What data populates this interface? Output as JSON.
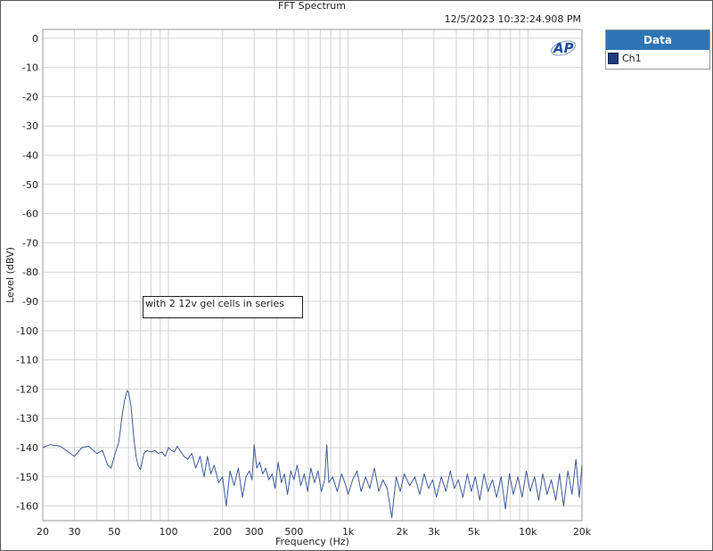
{
  "chart_data": {
    "type": "line",
    "title": "FFT Spectrum",
    "timestamp": "12/5/2023 10:32:24.908 PM",
    "xlabel": "Frequency (Hz)",
    "ylabel": "Level (dBV)",
    "xscale": "log",
    "xlim": [
      20,
      20000
    ],
    "ylim": [
      -165,
      3
    ],
    "grid": true,
    "legend_position": "right, outside plot",
    "legend_title": "Data",
    "annotation": "with 2 12v gel cells in series",
    "x_ticks": [
      {
        "value": 20,
        "label": "20"
      },
      {
        "value": 30,
        "label": "30"
      },
      {
        "value": 50,
        "label": "50"
      },
      {
        "value": 100,
        "label": "100"
      },
      {
        "value": 200,
        "label": "200"
      },
      {
        "value": 300,
        "label": "300"
      },
      {
        "value": 500,
        "label": "500"
      },
      {
        "value": 1000,
        "label": "1k"
      },
      {
        "value": 2000,
        "label": "2k"
      },
      {
        "value": 3000,
        "label": "3k"
      },
      {
        "value": 5000,
        "label": "5k"
      },
      {
        "value": 10000,
        "label": "10k"
      },
      {
        "value": 20000,
        "label": "20k"
      }
    ],
    "y_ticks": [
      0,
      -10,
      -20,
      -30,
      -40,
      -50,
      -60,
      -70,
      -80,
      -90,
      -100,
      -110,
      -120,
      -130,
      -140,
      -150,
      -160
    ],
    "series": [
      {
        "name": "Ch1",
        "color": "#3b5a9a",
        "points": [
          [
            20,
            -140
          ],
          [
            22,
            -139
          ],
          [
            25,
            -139.5
          ],
          [
            27,
            -141
          ],
          [
            30,
            -143
          ],
          [
            33,
            -140
          ],
          [
            36,
            -139.5
          ],
          [
            40,
            -142
          ],
          [
            43,
            -141
          ],
          [
            46,
            -146
          ],
          [
            48,
            -147
          ],
          [
            50,
            -143
          ],
          [
            53,
            -138
          ],
          [
            55,
            -130
          ],
          [
            57,
            -124
          ],
          [
            59,
            -120.5
          ],
          [
            60,
            -121
          ],
          [
            62,
            -126
          ],
          [
            64,
            -136
          ],
          [
            66,
            -143
          ],
          [
            68,
            -146.5
          ],
          [
            70,
            -147.5
          ],
          [
            73,
            -142
          ],
          [
            76,
            -141
          ],
          [
            80,
            -141.5
          ],
          [
            84,
            -141
          ],
          [
            88,
            -142
          ],
          [
            92,
            -141.5
          ],
          [
            96,
            -143
          ],
          [
            100,
            -140
          ],
          [
            104,
            -141
          ],
          [
            108,
            -141.5
          ],
          [
            112,
            -139.5
          ],
          [
            116,
            -141
          ],
          [
            122,
            -143
          ],
          [
            128,
            -144
          ],
          [
            135,
            -142
          ],
          [
            142,
            -147
          ],
          [
            150,
            -143
          ],
          [
            158,
            -150
          ],
          [
            165,
            -143
          ],
          [
            172,
            -149
          ],
          [
            180,
            -146
          ],
          [
            190,
            -152
          ],
          [
            200,
            -150
          ],
          [
            210,
            -160
          ],
          [
            220,
            -148
          ],
          [
            232,
            -153
          ],
          [
            245,
            -147
          ],
          [
            258,
            -157
          ],
          [
            270,
            -150
          ],
          [
            282,
            -148
          ],
          [
            292,
            -151
          ],
          [
            300,
            -139
          ],
          [
            310,
            -147
          ],
          [
            322,
            -145
          ],
          [
            335,
            -149
          ],
          [
            348,
            -147
          ],
          [
            362,
            -151
          ],
          [
            378,
            -149
          ],
          [
            392,
            -154
          ],
          [
            408,
            -145
          ],
          [
            425,
            -152
          ],
          [
            442,
            -149
          ],
          [
            460,
            -156
          ],
          [
            480,
            -148
          ],
          [
            500,
            -151
          ],
          [
            520,
            -146
          ],
          [
            545,
            -153
          ],
          [
            570,
            -149
          ],
          [
            595,
            -155
          ],
          [
            620,
            -147
          ],
          [
            650,
            -152
          ],
          [
            680,
            -148
          ],
          [
            710,
            -155
          ],
          [
            740,
            -151
          ],
          [
            760,
            -139
          ],
          [
            780,
            -152
          ],
          [
            820,
            -150
          ],
          [
            870,
            -155
          ],
          [
            920,
            -149
          ],
          [
            970,
            -153
          ],
          [
            1000,
            -156
          ],
          [
            1060,
            -151
          ],
          [
            1120,
            -148
          ],
          [
            1180,
            -155
          ],
          [
            1250,
            -150
          ],
          [
            1320,
            -154
          ],
          [
            1400,
            -147
          ],
          [
            1480,
            -155
          ],
          [
            1560,
            -151
          ],
          [
            1650,
            -154
          ],
          [
            1750,
            -164
          ],
          [
            1850,
            -150
          ],
          [
            1950,
            -155
          ],
          [
            2050,
            -149
          ],
          [
            2200,
            -153
          ],
          [
            2350,
            -150
          ],
          [
            2500,
            -156
          ],
          [
            2650,
            -149
          ],
          [
            2800,
            -154
          ],
          [
            2950,
            -151
          ],
          [
            3100,
            -157
          ],
          [
            3300,
            -150
          ],
          [
            3500,
            -155
          ],
          [
            3700,
            -148
          ],
          [
            3900,
            -154
          ],
          [
            4100,
            -151
          ],
          [
            4350,
            -157
          ],
          [
            4600,
            -149
          ],
          [
            4850,
            -155
          ],
          [
            5100,
            -150
          ],
          [
            5400,
            -158
          ],
          [
            5700,
            -149
          ],
          [
            6000,
            -155
          ],
          [
            6350,
            -151
          ],
          [
            6700,
            -157
          ],
          [
            7100,
            -150
          ],
          [
            7500,
            -161
          ],
          [
            7900,
            -149
          ],
          [
            8300,
            -156
          ],
          [
            8800,
            -150
          ],
          [
            9300,
            -157
          ],
          [
            9800,
            -148
          ],
          [
            10300,
            -155
          ],
          [
            10900,
            -150
          ],
          [
            11500,
            -158
          ],
          [
            12100,
            -149
          ],
          [
            12800,
            -156
          ],
          [
            13500,
            -151
          ],
          [
            14300,
            -158
          ],
          [
            15000,
            -149
          ],
          [
            15800,
            -160
          ],
          [
            16700,
            -148
          ],
          [
            17600,
            -156
          ],
          [
            18500,
            -144
          ],
          [
            19300,
            -157
          ],
          [
            20000,
            -146
          ]
        ]
      }
    ]
  }
}
